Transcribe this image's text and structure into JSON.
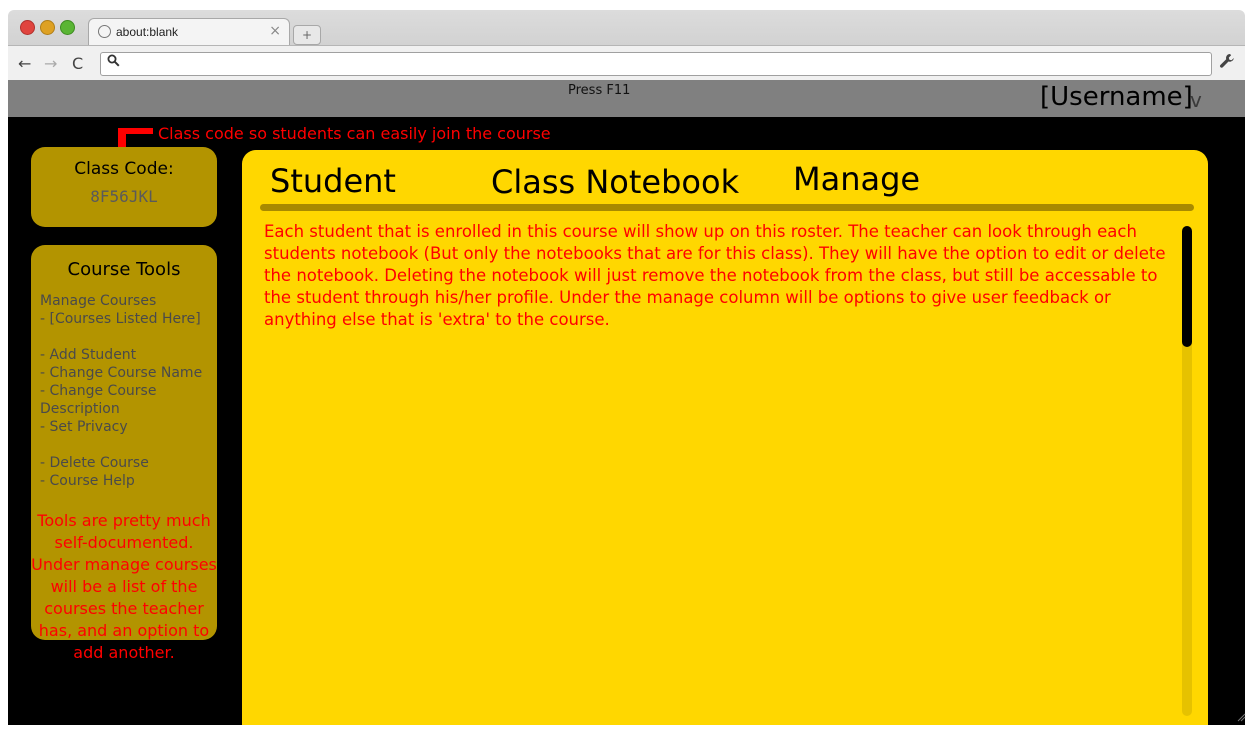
{
  "browser": {
    "tab_title": "about:blank",
    "tab_close_glyph": "×",
    "new_tab_glyph": "+",
    "back_glyph": "←",
    "forward_glyph": "→",
    "reload_glyph": "C",
    "address_value": "",
    "icons": [
      "back-arrow-icon",
      "forward-arrow-icon",
      "reload-icon",
      "search-icon",
      "wrench-icon",
      "globe-icon"
    ]
  },
  "header": {
    "press_hint": "Press F11",
    "username": "[Username]",
    "username_caret": "v"
  },
  "annotations": {
    "class_code_note": "Class code so students can easily join the course",
    "tools_note": "Tools are pretty much self-documented.  Under manage courses will be a list of the courses the teacher has, and an option to add another."
  },
  "class_code": {
    "label": "Class Code:",
    "value": "8F56JKL"
  },
  "course_tools": {
    "title": "Course Tools",
    "lines": [
      "Manage Courses",
      "- [Courses Listed Here]",
      "",
      "- Add Student",
      "- Change Course Name",
      "- Change Course",
      "Description",
      "- Set Privacy",
      "",
      "- Delete Course",
      "- Course Help"
    ]
  },
  "main": {
    "columns": [
      "Student",
      "Class Notebook",
      "Manage"
    ],
    "description": "Each student that is enrolled in this course will show up on this roster.  The teacher can look through each students notebook (But only the notebooks that are for this class).  They will have the option to edit or delete the notebook.  Deleting the notebook will just remove the notebook from the class, but still be accessable to the student through his/her profile.  Under the manage column will be options to give user feedback or anything else that is 'extra' to the course."
  },
  "colors": {
    "panel_yellow": "#ffd700",
    "sidebar_gold": "#b39400",
    "annotation_red": "#ff0000",
    "topbar_gray": "#808080",
    "page_black": "#000000"
  }
}
